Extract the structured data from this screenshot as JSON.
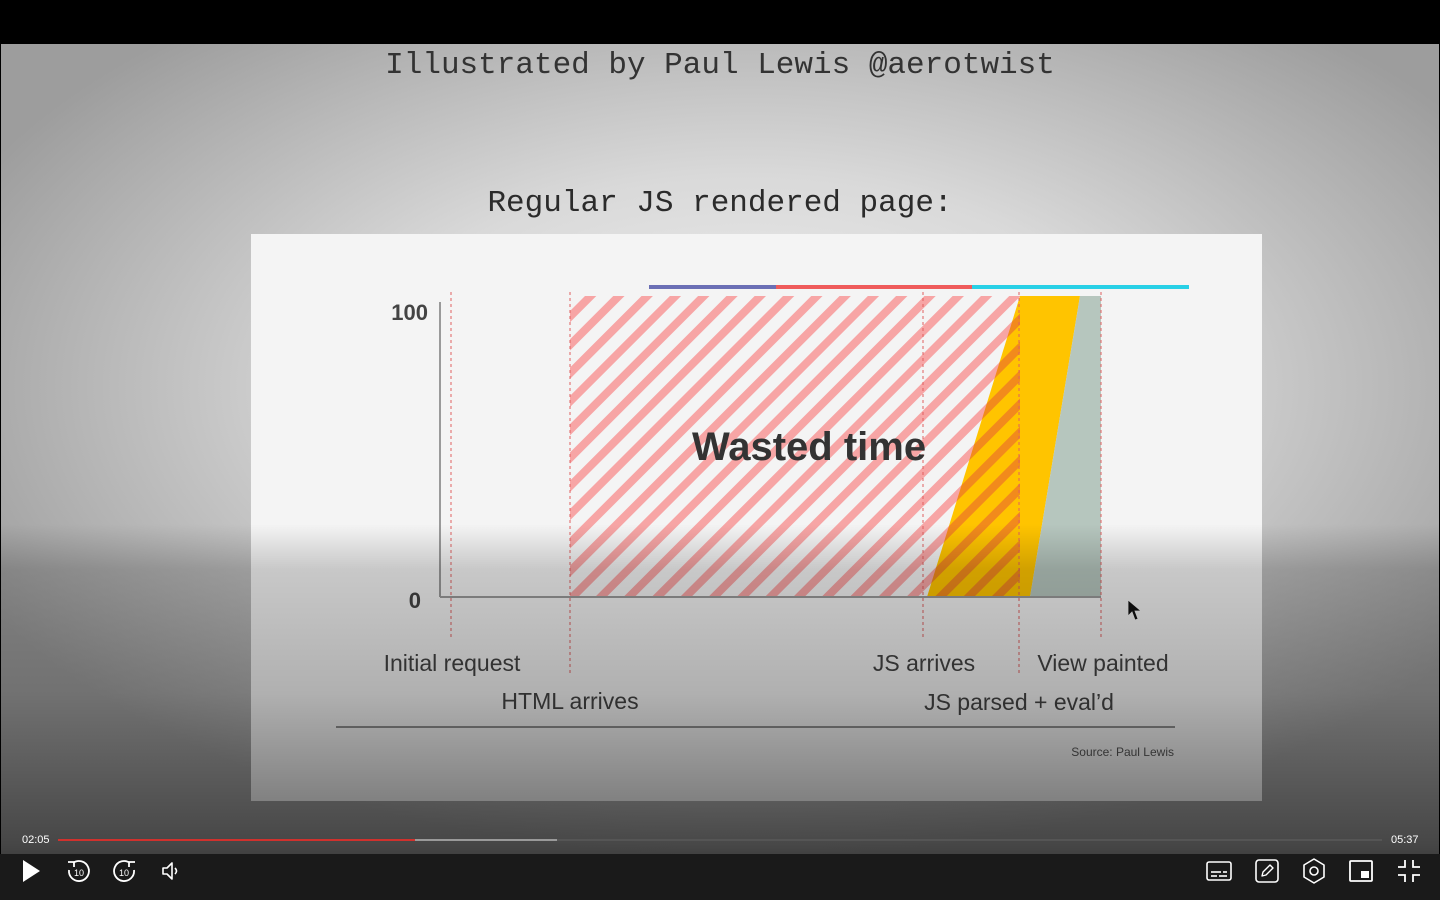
{
  "slide": {
    "header": "Illustrated by Paul Lewis @aerotwist",
    "subtitle": "Regular JS rendered page:",
    "y_max_label": "100",
    "y_min_label": "0",
    "annotation": "Wasted time",
    "labels": {
      "initial_request": "Initial request",
      "html_arrives": "HTML arrives",
      "js_arrives": "JS arrives",
      "view_painted": "View painted",
      "js_parsed": "JS parsed + eval’d"
    },
    "source": "Source: Paul Lewis"
  },
  "colors": {
    "hatch": "#f7a5a5",
    "blocked": "#ffc400",
    "painted": "#b6c6be",
    "marker_line": "#e06060",
    "bar_blue": "#6b6fb5",
    "bar_red": "#ef5b5b",
    "bar_cyan": "#28d0e6",
    "progress_played": "#d0312d"
  },
  "player": {
    "current_time": "02:05",
    "total_time": "05:37",
    "played_fraction": 0.27,
    "buffered_fraction": 0.377,
    "controls_left": [
      "play-icon",
      "rewind-10-icon",
      "forward-10-icon",
      "volume-icon"
    ],
    "controls_right": [
      "captions-icon",
      "notes-icon",
      "settings-icon",
      "picture-in-picture-icon",
      "exit-fullscreen-icon"
    ]
  }
}
